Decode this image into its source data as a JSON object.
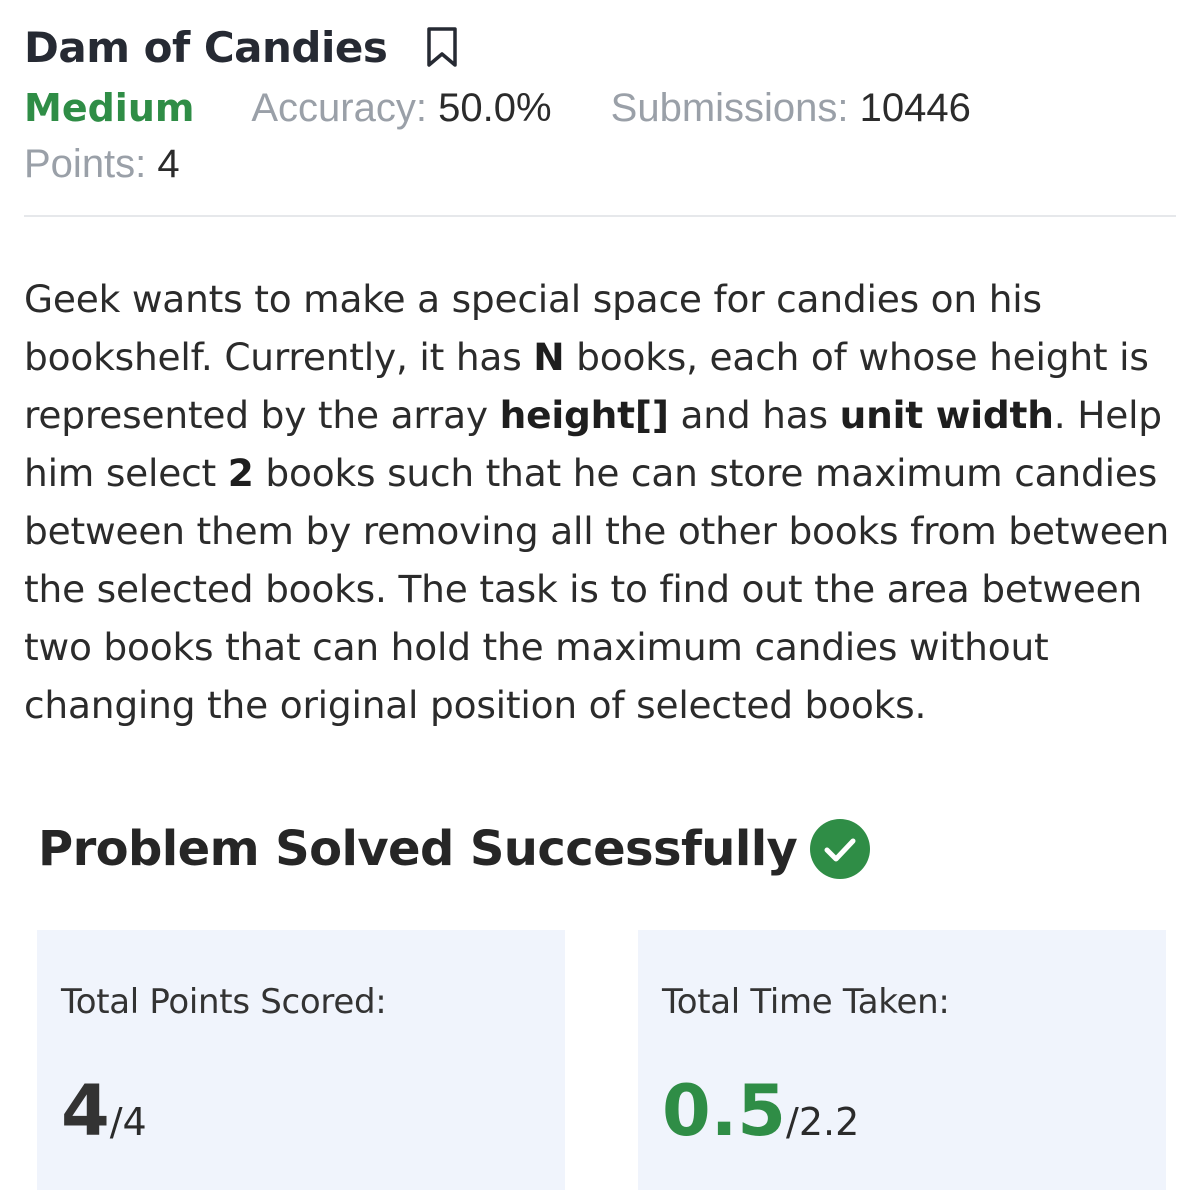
{
  "problem": {
    "title": "Dam of Candies",
    "difficulty": "Medium",
    "accuracy_label": "Accuracy:",
    "accuracy_value": "50.0%",
    "submissions_label": "Submissions:",
    "submissions_value": "10446",
    "points_label": "Points:",
    "points_value": "4"
  },
  "description": {
    "p1": "Geek wants to make a special space for candies on his bookshelf. Currently, it has ",
    "b1": "N",
    "p2": " books, each of whose height is represented by the array ",
    "b2": "height[]",
    "p3": " and has ",
    "b3": "unit width",
    "p4": ". Help him select ",
    "b4": "2",
    "p5": " books such that he can store maximum candies between them by removing all the other books from between the selected books. The task is to find out the area between two books that can hold the maximum candies without changing the original position of selected books."
  },
  "result": {
    "message": "Problem Solved Successfully",
    "points_label": "Total Points Scored:",
    "points_scored": "4",
    "points_total": "/4",
    "time_label": "Total Time Taken:",
    "time_taken": "0.5",
    "time_total": "/2.2"
  },
  "colors": {
    "accent_green": "#2f8d46",
    "card_bg": "#f0f4fc"
  },
  "icons": {
    "bookmark": "bookmark-icon",
    "success": "check-circle-icon"
  }
}
